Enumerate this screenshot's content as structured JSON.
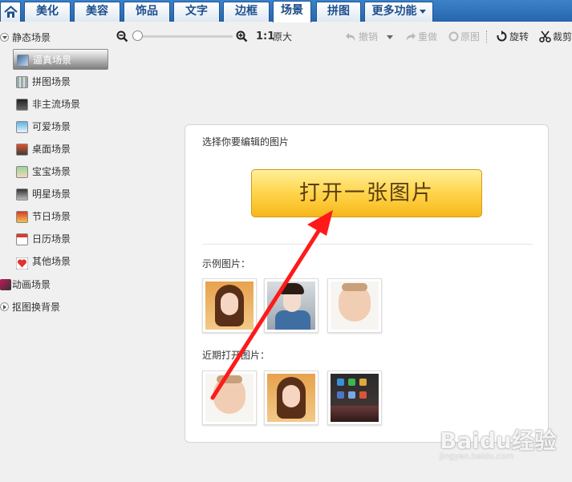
{
  "tabs": [
    {
      "label": "",
      "icon": "home-icon"
    },
    {
      "label": "美化"
    },
    {
      "label": "美容"
    },
    {
      "label": "饰品"
    },
    {
      "label": "文字"
    },
    {
      "label": "边框"
    },
    {
      "label": "场景",
      "active": true
    },
    {
      "label": "拼图"
    },
    {
      "label": "更多功能"
    }
  ],
  "toolbar": {
    "ratio_label": "1:1",
    "original_size": "原大",
    "undo": "撤销",
    "redo": "重做",
    "original": "原图",
    "rotate": "旋转",
    "crop": "裁剪"
  },
  "sidebar": {
    "groups": [
      {
        "label": "静态场景",
        "expanded": true
      },
      {
        "label": "动画场景"
      },
      {
        "label": "抠图换背景"
      }
    ],
    "items": [
      {
        "label": "逼真场景",
        "selected": true
      },
      {
        "label": "拼图场景"
      },
      {
        "label": "非主流场景"
      },
      {
        "label": "可爱场景"
      },
      {
        "label": "桌面场景"
      },
      {
        "label": "宝宝场景"
      },
      {
        "label": "明星场景"
      },
      {
        "label": "节日场景"
      },
      {
        "label": "日历场景"
      },
      {
        "label": "其他场景"
      }
    ]
  },
  "card": {
    "title": "选择你要编辑的图片",
    "open_button": "打开一张图片",
    "examples_label": "示例图片：",
    "recent_label": "近期打开图片："
  },
  "watermark": {
    "brand": "Baidu经验",
    "url": "jingyan.baidu.com"
  },
  "colors": {
    "tabbar": "#2e70b8",
    "button": "#ffd44a",
    "arrow": "#ff1a1a"
  }
}
